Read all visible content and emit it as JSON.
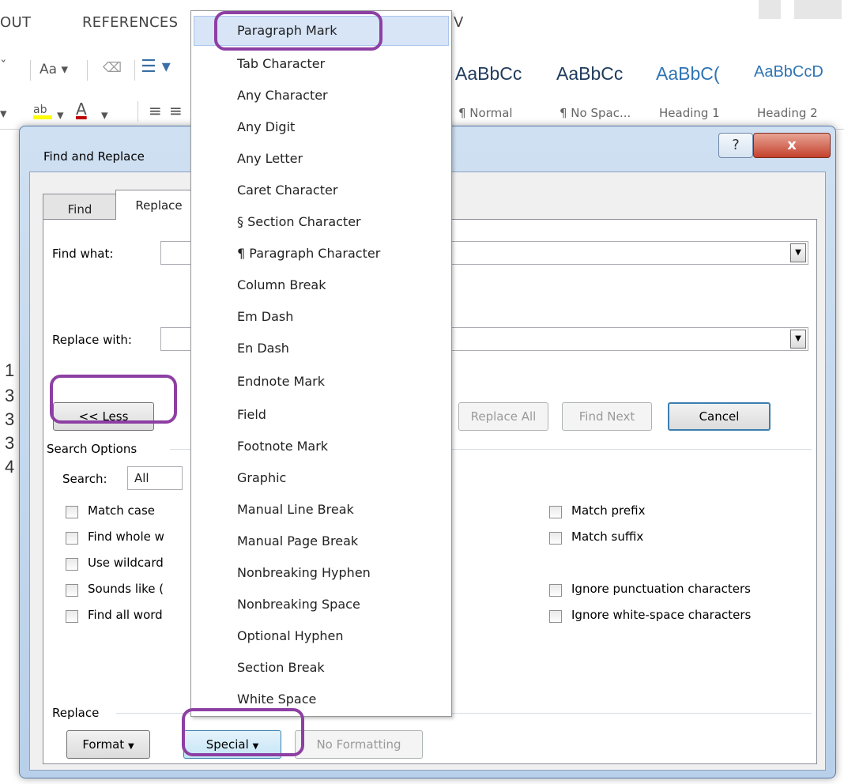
{
  "ribbon": {
    "tabs": [
      "OUT",
      "REFERENCES",
      "V"
    ],
    "font_size_label": "Aa",
    "highlight_label": "ab",
    "font_color_label": "A",
    "styles": [
      {
        "sample": "AaBbCc",
        "name": "¶ Normal"
      },
      {
        "sample": "AaBbCc",
        "name": "¶ No Spac..."
      },
      {
        "sample": "AaBbC(",
        "name": "Heading 1"
      },
      {
        "sample": "AaBbCcD",
        "name": "Heading 2"
      }
    ]
  },
  "document": {
    "line_numbers": [
      "1",
      "3",
      "3",
      "3",
      "4"
    ]
  },
  "dialog": {
    "title": "Find and Replace",
    "help_label": "?",
    "close_label": "x",
    "tabs": {
      "find": "Find",
      "replace": "Replace"
    },
    "find_what_label": "Find what:",
    "replace_with_label": "Replace with:",
    "buttons": {
      "less": "<< Less",
      "replace_all": "Replace All",
      "find_next": "Find Next",
      "cancel": "Cancel",
      "format": "Format",
      "special": "Special",
      "no_formatting": "No Formatting"
    },
    "search_options_label": "Search Options",
    "search_label": "Search:",
    "search_value": "All",
    "options_left": [
      "Match case",
      "Find whole w",
      "Use wildcard",
      "Sounds like (",
      "Find all word"
    ],
    "options_right": [
      "Match prefix",
      "Match suffix",
      "Ignore punctuation characters",
      "Ignore white-space characters"
    ],
    "replace_group_label": "Replace"
  },
  "special_menu": {
    "items": [
      "Paragraph Mark",
      "Tab Character",
      "Any Character",
      "Any Digit",
      "Any Letter",
      "Caret Character",
      "§ Section Character",
      "¶ Paragraph Character",
      "Column Break",
      "Em Dash",
      "En Dash",
      "Endnote Mark",
      "Field",
      "Footnote Mark",
      "Graphic",
      "Manual Line Break",
      "Manual Page Break",
      "Nonbreaking Hyphen",
      "Nonbreaking Space",
      "Optional Hyphen",
      "Section Break",
      "White Space"
    ],
    "hovered_index": 0
  },
  "colors": {
    "annotation": "#8d3fa3",
    "menu_hover": "#d7e5f7",
    "font_color_bar": "#c00000",
    "highlight_bar": "#ffff00"
  }
}
